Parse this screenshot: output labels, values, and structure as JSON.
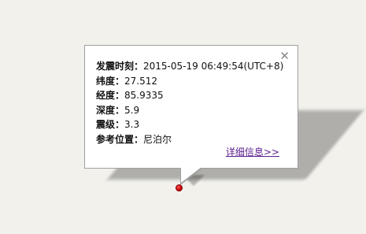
{
  "info_window": {
    "close_symbol": "✕",
    "fields": [
      {
        "label": "发震时刻：",
        "value": "2015-05-19 06:49:54(UTC+8)"
      },
      {
        "label": "纬度：",
        "value": "27.512"
      },
      {
        "label": "经度：",
        "value": "85.9335"
      },
      {
        "label": "深度：",
        "value": "5.9"
      },
      {
        "label": "震级：",
        "value": "3.3"
      },
      {
        "label": "参考位置：",
        "value": "尼泊尔"
      }
    ],
    "detail_link": "详细信息>>"
  },
  "marker": {
    "color": "#d00000"
  }
}
